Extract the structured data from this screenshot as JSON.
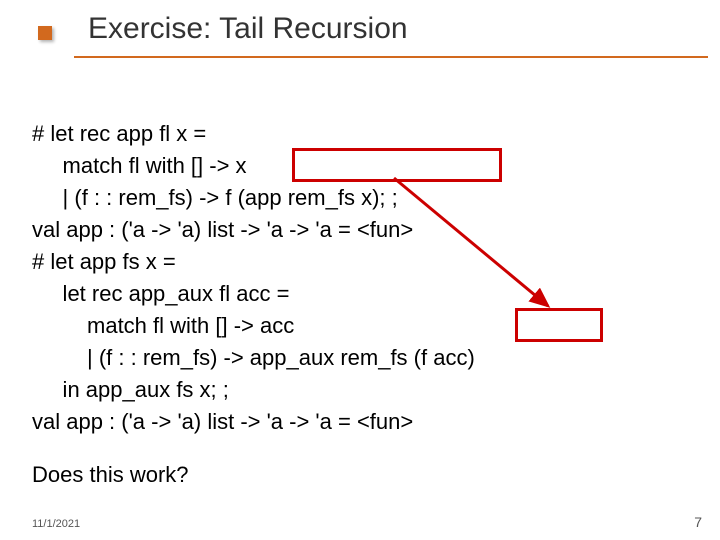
{
  "title": "Exercise: Tail Recursion",
  "code": {
    "l1": "# let rec app fl x =",
    "l2": "     match fl with [] -> x",
    "l3": "     | (f : : rem_fs) -> f (app rem_fs x); ;",
    "l4": "val app : ('a -> 'a) list -> 'a -> 'a = <fun>",
    "l5": "# let app fs x =",
    "l6": "     let rec app_aux fl acc =",
    "l7": "         match fl with [] -> acc",
    "l8": "         | (f : : rem_fs) -> app_aux rem_fs (f acc)",
    "l9": "     in app_aux fs x; ;",
    "l10": "val app : ('a -> 'a) list -> 'a -> 'a = <fun>"
  },
  "question": "Does this work?",
  "footer": {
    "date": "11/1/2021",
    "page": "7"
  },
  "highlights": {
    "box1_desc": "f (app rem_fs x);",
    "box2_desc": "(f acc)",
    "arrow_desc": "arrow from box1 to box2"
  }
}
